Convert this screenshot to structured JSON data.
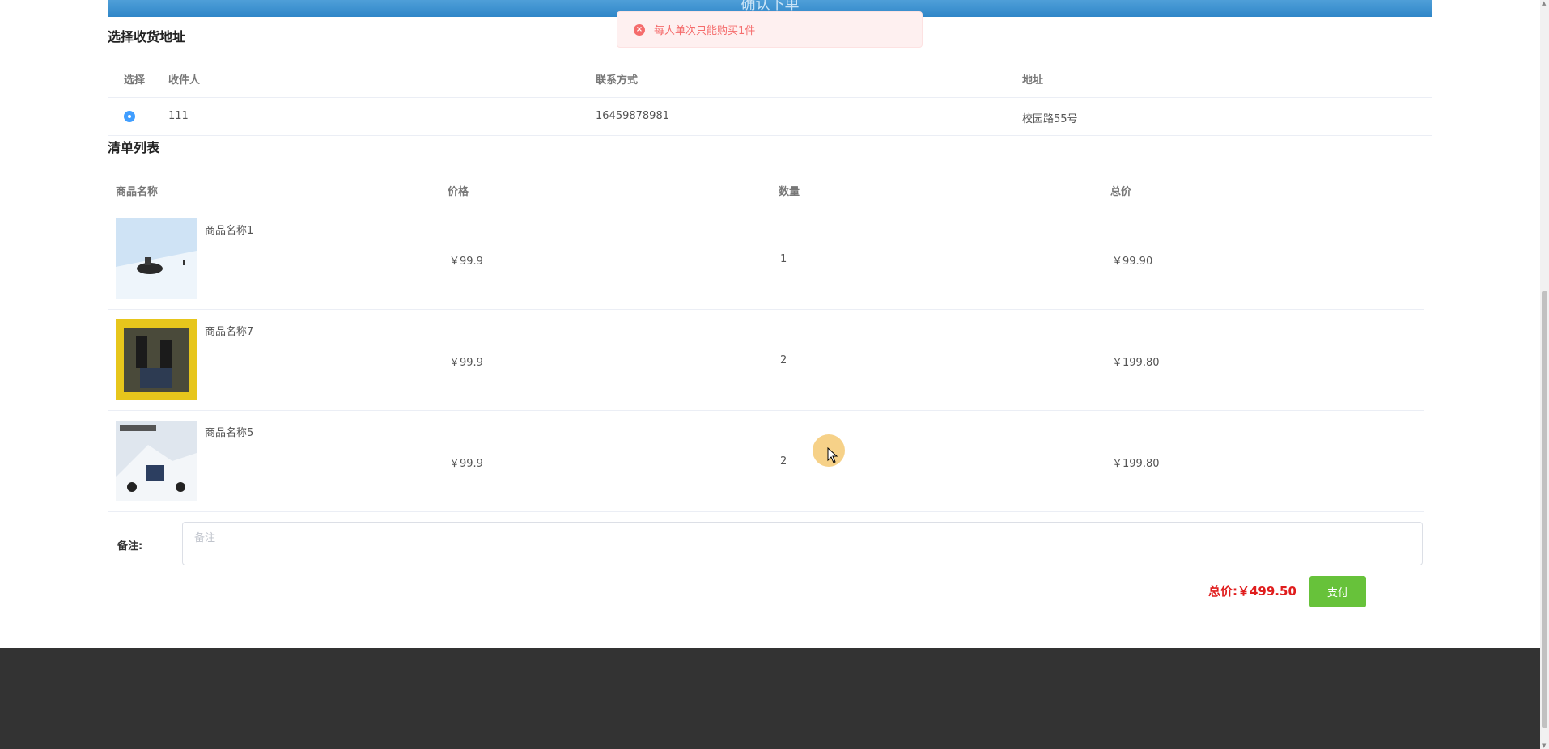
{
  "header": {
    "title": "确认下单"
  },
  "toast": {
    "message": "每人单次只能购买1件"
  },
  "address_section": {
    "title": "选择收货地址",
    "columns": [
      "选择",
      "收件人",
      "联系方式",
      "地址"
    ],
    "rows": [
      {
        "name": "111",
        "phone": "16459878981",
        "address": "校园路55号",
        "selected": true
      }
    ]
  },
  "list_section": {
    "title": "清单列表",
    "columns": [
      "商品名称",
      "价格",
      "数量",
      "总价"
    ],
    "rows": [
      {
        "name": "商品名称1",
        "price": "￥99.9",
        "qty": "1",
        "total": "￥99.90"
      },
      {
        "name": "商品名称7",
        "price": "￥99.9",
        "qty": "2",
        "total": "￥199.80"
      },
      {
        "name": "商品名称5",
        "price": "￥99.9",
        "qty": "2",
        "total": "￥199.80"
      }
    ]
  },
  "remark": {
    "label": "备注:",
    "placeholder": "备注",
    "value": ""
  },
  "summary": {
    "total_label": "总价:",
    "total_value": "￥499.50"
  },
  "pay_button": {
    "label": "支付"
  },
  "colors": {
    "primary": "#409eff",
    "pay": "#67c23a",
    "total": "#e01d1d",
    "toast_bg": "#fef0f0",
    "footer": "#333333"
  }
}
